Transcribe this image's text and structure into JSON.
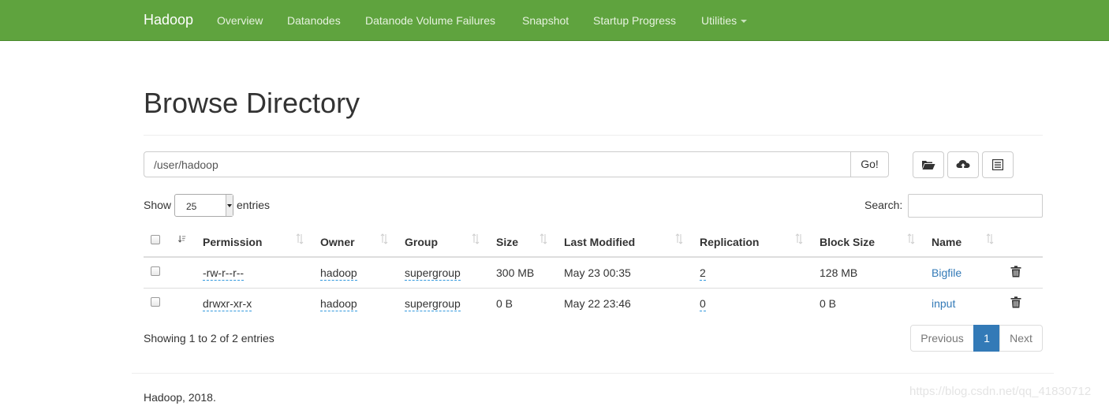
{
  "navbar": {
    "brand": "Hadoop",
    "items": [
      "Overview",
      "Datanodes",
      "Datanode Volume Failures",
      "Snapshot",
      "Startup Progress",
      "Utilities"
    ],
    "bg_color": "#5fa33e"
  },
  "page": {
    "title": "Browse Directory"
  },
  "pathbar": {
    "path": "/user/hadoop",
    "go_label": "Go!"
  },
  "toolbar": {
    "icons": [
      "folder-open-icon",
      "cloud-upload-icon",
      "list-icon"
    ]
  },
  "entries": {
    "show_label": "Show",
    "value": "25",
    "suffix": "entries"
  },
  "search": {
    "label": "Search:",
    "value": ""
  },
  "table": {
    "headers": [
      "Permission",
      "Owner",
      "Group",
      "Size",
      "Last Modified",
      "Replication",
      "Block Size",
      "Name"
    ],
    "rows": [
      {
        "permission": "-rw-r--r--",
        "owner": "hadoop",
        "group": "supergroup",
        "size": "300 MB",
        "modified": "May 23 00:35",
        "replication": "2",
        "block_size": "128 MB",
        "name": "Bigfile"
      },
      {
        "permission": "drwxr-xr-x",
        "owner": "hadoop",
        "group": "supergroup",
        "size": "0 B",
        "modified": "May 22 23:46",
        "replication": "0",
        "block_size": "0 B",
        "name": "input"
      }
    ]
  },
  "info": "Showing 1 to 2 of 2 entries",
  "pagination": {
    "previous": "Previous",
    "current": "1",
    "next": "Next"
  },
  "footer": {
    "text": "Hadoop, 2018."
  },
  "watermark": "https://blog.csdn.net/qq_41830712",
  "colors": {
    "link": "#337ab7",
    "active_page": "#337ab7"
  }
}
